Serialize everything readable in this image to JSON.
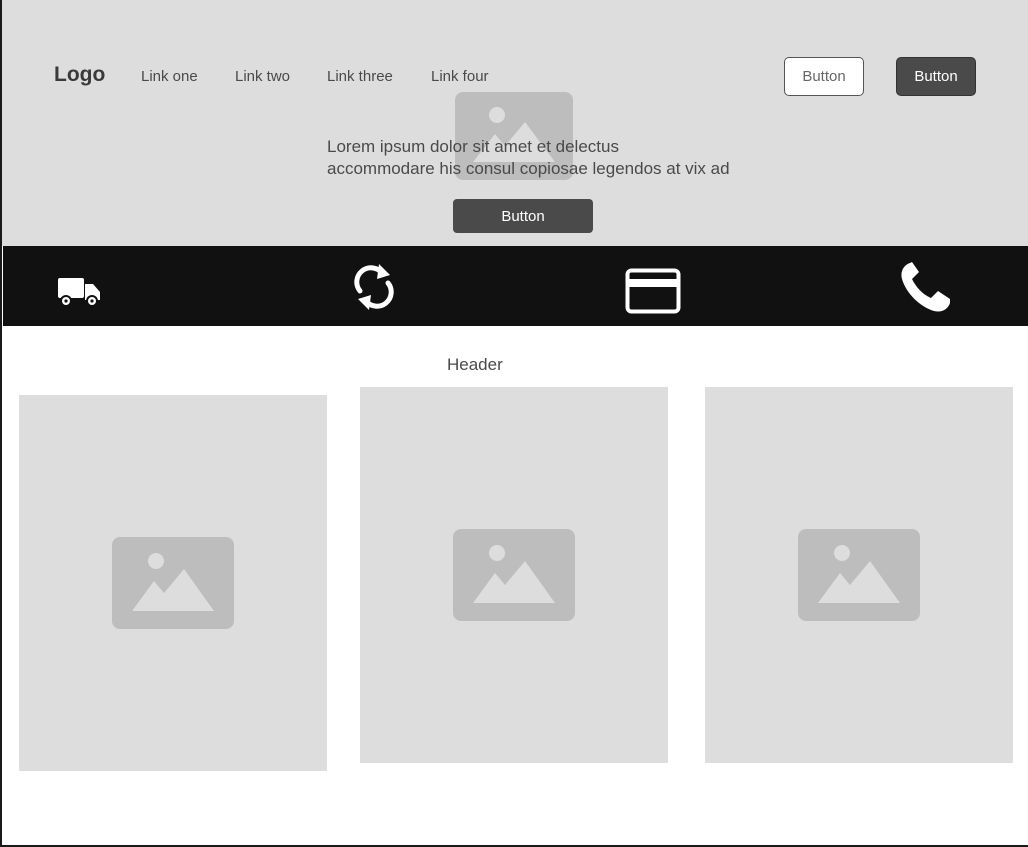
{
  "nav": {
    "logo": "Logo",
    "links": [
      {
        "label": "Link one"
      },
      {
        "label": "Link two"
      },
      {
        "label": "Link three"
      },
      {
        "label": "Link four"
      }
    ],
    "secondary_button": "Button",
    "primary_button": "Button"
  },
  "hero": {
    "text_line1": "Lorem ipsum dolor sit amet et delectus",
    "text_line2": "accommodare his consul copiosae legendos at vix ad",
    "button": "Button",
    "image_icon": "image-placeholder-icon"
  },
  "features": {
    "icons": [
      "truck-icon",
      "refresh-icon",
      "credit-card-icon",
      "phone-icon"
    ]
  },
  "section": {
    "header": "Header"
  },
  "cards": [
    {
      "image_icon": "image-placeholder-icon"
    },
    {
      "image_icon": "image-placeholder-icon"
    },
    {
      "image_icon": "image-placeholder-icon"
    }
  ],
  "colors": {
    "hero_bg": "#dddddd",
    "feature_bar_bg": "#111111",
    "dark_button": "#4a4a4a",
    "placeholder": "#bdbdbd"
  }
}
